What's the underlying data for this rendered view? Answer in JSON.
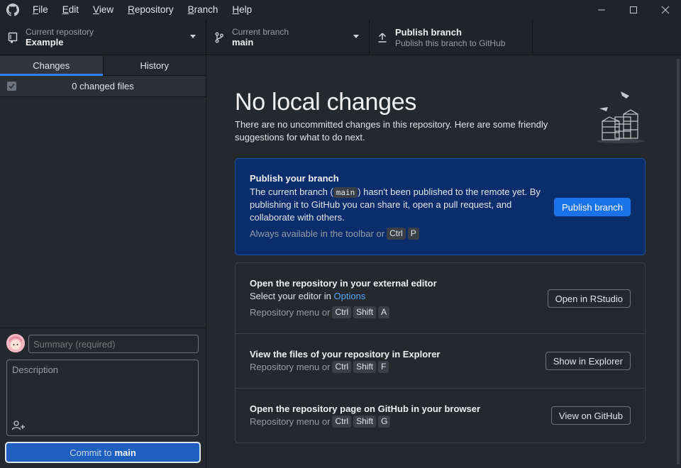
{
  "menu": [
    "File",
    "Edit",
    "View",
    "Repository",
    "Branch",
    "Help"
  ],
  "menu_mnemonics": [
    "F",
    "E",
    "V",
    "R",
    "B",
    "H"
  ],
  "menu_rest": [
    "ile",
    "dit",
    "iew",
    "epository",
    "ranch",
    "elp"
  ],
  "toolbar": {
    "repo_sub": "Current repository",
    "repo_name": "Example",
    "branch_sub": "Current branch",
    "branch_name": "main",
    "publish_title": "Publish branch",
    "publish_sub": "Publish this branch to GitHub"
  },
  "sidebar": {
    "tab_changes": "Changes",
    "tab_history": "History",
    "changed_files": "0 changed files",
    "summary_placeholder": "Summary (required)",
    "description_placeholder": "Description",
    "commit_prefix": "Commit to",
    "commit_branch": "main"
  },
  "main": {
    "heading": "No local changes",
    "subtext": "There are no uncommitted changes in this repository. Here are some friendly suggestions for what to do next.",
    "publish": {
      "title": "Publish your branch",
      "body_pre": "The current branch (",
      "body_code": "main",
      "body_post": ") hasn't been published to the remote yet. By publishing it to GitHub you can share it, open a pull request, and collaborate with others.",
      "hint": "Always available in the toolbar or",
      "keys": [
        "Ctrl",
        "P"
      ],
      "button": "Publish branch"
    },
    "editor": {
      "title": "Open the repository in your external editor",
      "body_pre": "Select your editor in",
      "body_link": "Options",
      "hint": "Repository menu or",
      "keys": [
        "Ctrl",
        "Shift",
        "A"
      ],
      "button": "Open in RStudio"
    },
    "explorer": {
      "title": "View the files of your repository in Explorer",
      "hint": "Repository menu or",
      "keys": [
        "Ctrl",
        "Shift",
        "F"
      ],
      "button": "Show in Explorer"
    },
    "github": {
      "title": "Open the repository page on GitHub in your browser",
      "hint": "Repository menu or",
      "keys": [
        "Ctrl",
        "Shift",
        "G"
      ],
      "button": "View on GitHub"
    }
  },
  "colors": {
    "background": "#24292e",
    "chrome": "#1f2428",
    "accent": "#2f81f7",
    "primary_card": "#0c2d6b",
    "primary_button": "#1a73e8",
    "link": "#58a6ff"
  },
  "icons": [
    "github-logo-icon",
    "minimize-icon",
    "maximize-icon",
    "close-icon",
    "repo-icon",
    "branch-icon",
    "upload-icon",
    "check-icon",
    "add-coauthor-icon"
  ]
}
